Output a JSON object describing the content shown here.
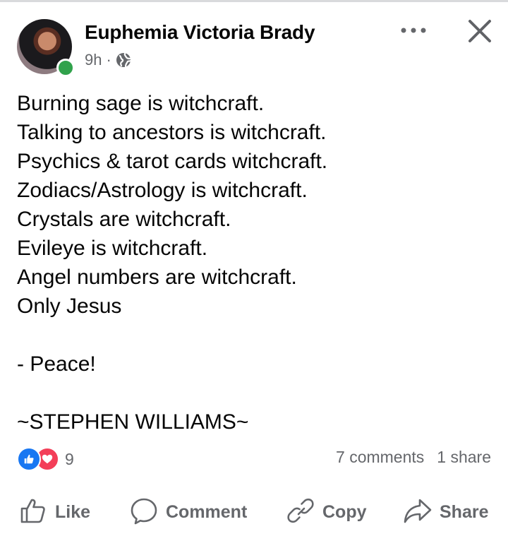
{
  "post": {
    "author": "Euphemia Victoria Brady",
    "time": "9h",
    "separator": "·",
    "audience_icon": "globe-icon",
    "lines": [
      "Burning sage is witchcraft.",
      "Talking to ancestors is witchcraft.",
      "Psychics & tarot cards witchcraft.",
      "Zodiacs/Astrology is witchcraft.",
      "Crystals are witchcraft.",
      "Evileye is witchcraft.",
      "Angel numbers are witchcraft.",
      "Only Jesus",
      "",
      "- Peace!",
      "",
      "~STEPHEN WILLIAMS~"
    ]
  },
  "engagement": {
    "reaction_count": "9",
    "comments": "7 comments",
    "shares": "1 share"
  },
  "actions": {
    "like": "Like",
    "comment": "Comment",
    "copy": "Copy",
    "share": "Share"
  },
  "colors": {
    "online": "#31a24c",
    "like": "#1877f2",
    "love": "#f33e58",
    "secondary_text": "#65676b"
  }
}
